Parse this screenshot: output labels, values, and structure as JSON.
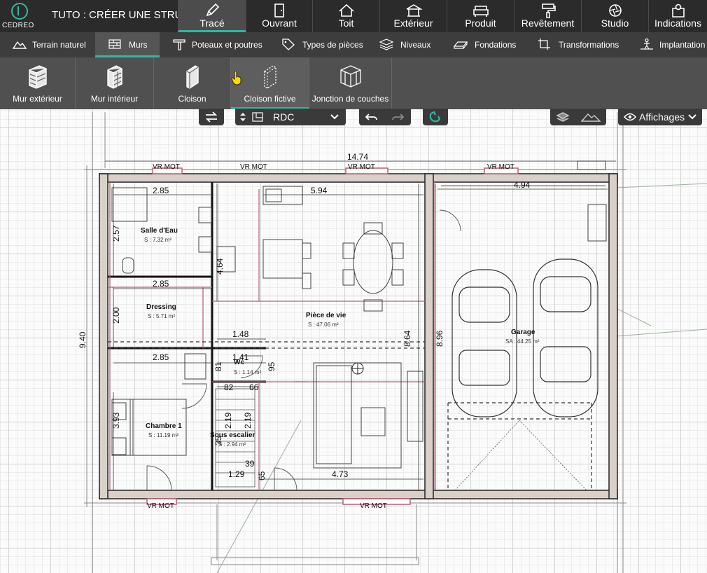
{
  "app": {
    "logo_text": "CEDREO",
    "project_title": "TUTO : CRÉER UNE STRU...",
    "accent": "#2fb8a6"
  },
  "main_tabs": [
    {
      "label": "Tracé",
      "icon": "pencil-icon",
      "active": true
    },
    {
      "label": "Ouvrant",
      "icon": "door-icon"
    },
    {
      "label": "Toit",
      "icon": "roof-icon"
    },
    {
      "label": "Extérieur",
      "icon": "gazebo-icon"
    },
    {
      "label": "Produit",
      "icon": "sofa-icon"
    },
    {
      "label": "Revêtement",
      "icon": "paint-roller-icon"
    },
    {
      "label": "Studio",
      "icon": "camera-aperture-icon"
    },
    {
      "label": "Indications",
      "icon": "map-pin-icon"
    }
  ],
  "sub_tabs": [
    {
      "label": "Terrain naturel",
      "icon": "terrain-icon"
    },
    {
      "label": "Murs",
      "icon": "brick-wall-icon",
      "active": true
    },
    {
      "label": "Poteaux et poutres",
      "icon": "beam-icon"
    },
    {
      "label": "Types de pièces",
      "icon": "tag-icon"
    },
    {
      "label": "Niveaux",
      "icon": "layers-icon"
    },
    {
      "label": "Fondations",
      "icon": "foundation-icon"
    },
    {
      "label": "Transformations",
      "icon": "transform-icon"
    },
    {
      "label": "Implantation",
      "icon": "person-icon"
    }
  ],
  "tools": [
    {
      "label": "Mur extérieur",
      "icon": "exterior-wall-icon"
    },
    {
      "label": "Mur intérieur",
      "icon": "interior-wall-icon"
    },
    {
      "label": "Cloison",
      "icon": "partition-icon"
    },
    {
      "label": "Cloison fictive",
      "icon": "virtual-partition-icon",
      "active": true
    },
    {
      "label": "Jonction de couches",
      "icon": "layer-junction-icon"
    }
  ],
  "controls": {
    "level_value": "RDC",
    "display_label": "Affichages"
  },
  "plan": {
    "rooms": [
      {
        "name": "Salle d'Eau",
        "area": "S : 7.32 m²"
      },
      {
        "name": "Dressing",
        "area": "S : 5.71 m²"
      },
      {
        "name": "Pièce de vie",
        "area": "S : 47.06 m²"
      },
      {
        "name": "Wc",
        "area": "S : 1.14 m²"
      },
      {
        "name": "Chambre 1",
        "area": "S : 11.19 m²"
      },
      {
        "name": "Sous escalier",
        "area": "S : 2.94 m²"
      },
      {
        "name": "Garage",
        "area": "SA : 44.25 m²"
      }
    ],
    "dims": [
      "14.74",
      "2.85",
      "5.94",
      "4.94",
      "2.57",
      "4.64",
      "2.85",
      "2.00",
      "9.40",
      "1.48",
      "8.64",
      "8.96",
      "2.85",
      "1.41",
      "81",
      "95",
      "82",
      "66",
      "3.93",
      "2.19",
      "2.19",
      "35",
      "39",
      "1.29",
      "65",
      "4.73"
    ],
    "vr_label": "VR MOT"
  }
}
